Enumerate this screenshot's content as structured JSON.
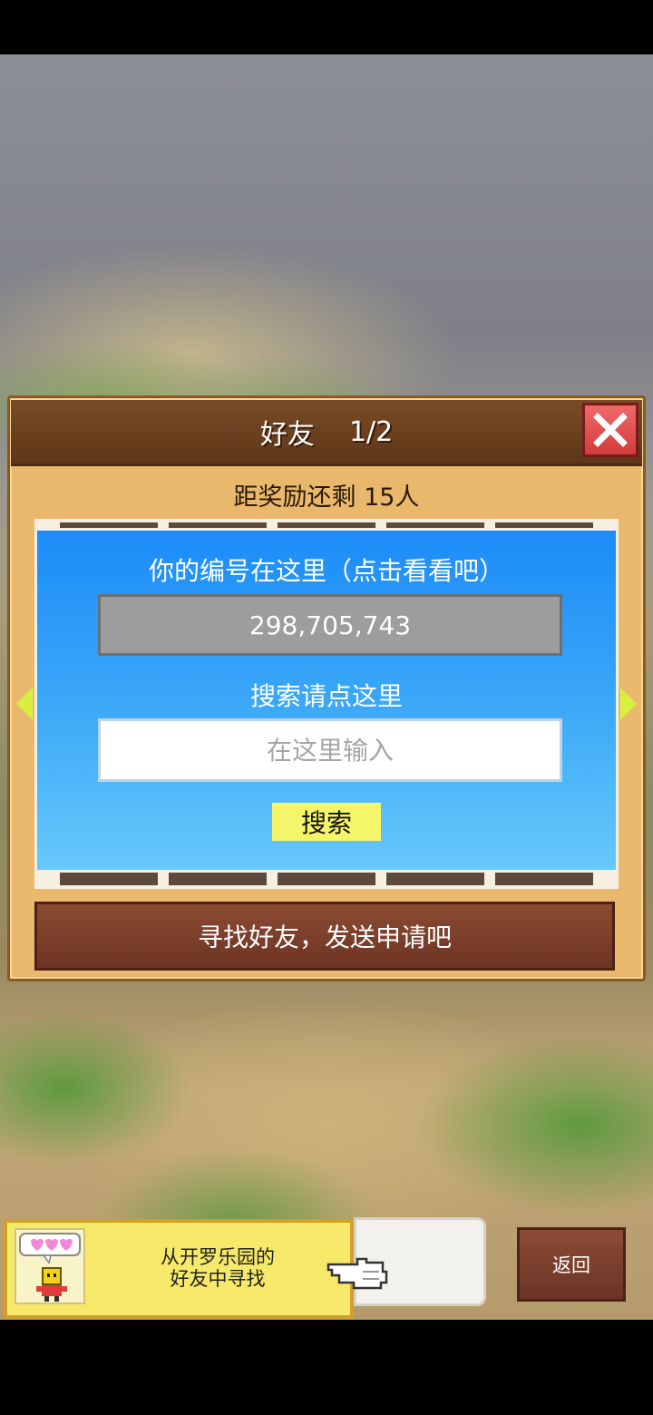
{
  "header": {
    "title": "好友",
    "page_indicator": "1/2"
  },
  "reward_text": "距奖励还剩 15人",
  "id_section": {
    "label": "你的编号在这里（点击看看吧）",
    "player_id": "298,705,743"
  },
  "search_section": {
    "label": "搜索请点这里",
    "input_value": "",
    "input_placeholder": "在这里输入",
    "button_label": "搜索"
  },
  "find_friends_button": "寻找好友，发送申请吧",
  "kairo_card": {
    "line1": "从开罗乐园的",
    "line2": "好友中寻找"
  },
  "back_button": "返回",
  "icons": [
    "close-icon",
    "arrow-left-icon",
    "arrow-right-icon",
    "pointing-hand-icon",
    "mascot-avatar-icon",
    "hearts-bubble-icon"
  ],
  "colors": {
    "panel": "#e9b86c",
    "header": "#6a3f20",
    "blue_box": "#1c8cf8",
    "search_button": "#f5f56a",
    "find_button": "#7a3f2b",
    "close_button": "#e04848"
  }
}
